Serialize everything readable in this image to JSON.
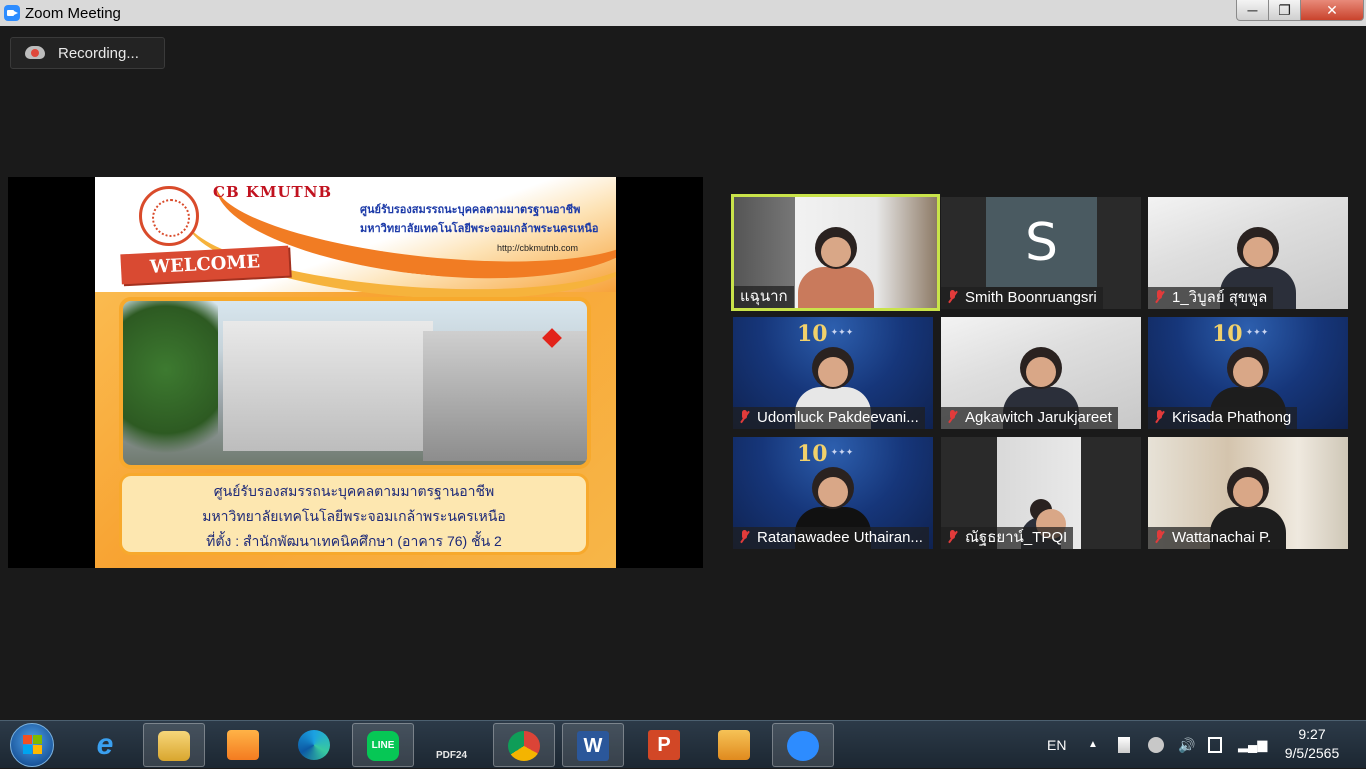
{
  "window": {
    "title": "Zoom Meeting"
  },
  "recording": {
    "label": "Recording..."
  },
  "shared_screen": {
    "brand": "CB KMUTNB",
    "header_line1": "ศูนย์รับรองสมรรถนะบุคคลตามมาตรฐานอาชีพ",
    "header_line2": "มหาวิทยาลัยเทคโนโลยีพระจอมเกล้าพระนครเหนือ",
    "url": "http://cbkmutnb.com",
    "welcome": "WELCOME",
    "info_line1": "ศูนย์รับรองสมรรถนะบุคคลตามมาตรฐานอาชีพ",
    "info_line2": "มหาวิทยาลัยเทคโนโลยีพระจอมเกล้าพระนครเหนือ",
    "info_line3": "ที่ตั้ง : สำนักพัฒนาเทคนิคศึกษา (อาคาร 76) ชั้น 2"
  },
  "participants": [
    {
      "name": "แฉุนาก",
      "muted": false,
      "active_speaker": true
    },
    {
      "name": "Smith Boonruangsri",
      "muted": true,
      "avatar_letter": "S"
    },
    {
      "name": "1_วิบูลย์  สุขพูล",
      "muted": true
    },
    {
      "name": "Udomluck Pakdeevani...",
      "muted": true
    },
    {
      "name": "Agkawitch Jarukjareet",
      "muted": true
    },
    {
      "name": "Krisada Phathong",
      "muted": true
    },
    {
      "name": "Ratanawadee Uthairan...",
      "muted": true
    },
    {
      "name": "ณัฐธยาน์_TPQI",
      "muted": true
    },
    {
      "name": "Wattanachai P.",
      "muted": true
    }
  ],
  "taskbar": {
    "language": "EN",
    "time": "9:27",
    "date": "9/5/2565",
    "pdf_label": "PDF24"
  },
  "colors": {
    "active_speaker_border": "#c9e34a",
    "muted_mic": "#e23b3b",
    "zoom_blue": "#2d8cff"
  }
}
